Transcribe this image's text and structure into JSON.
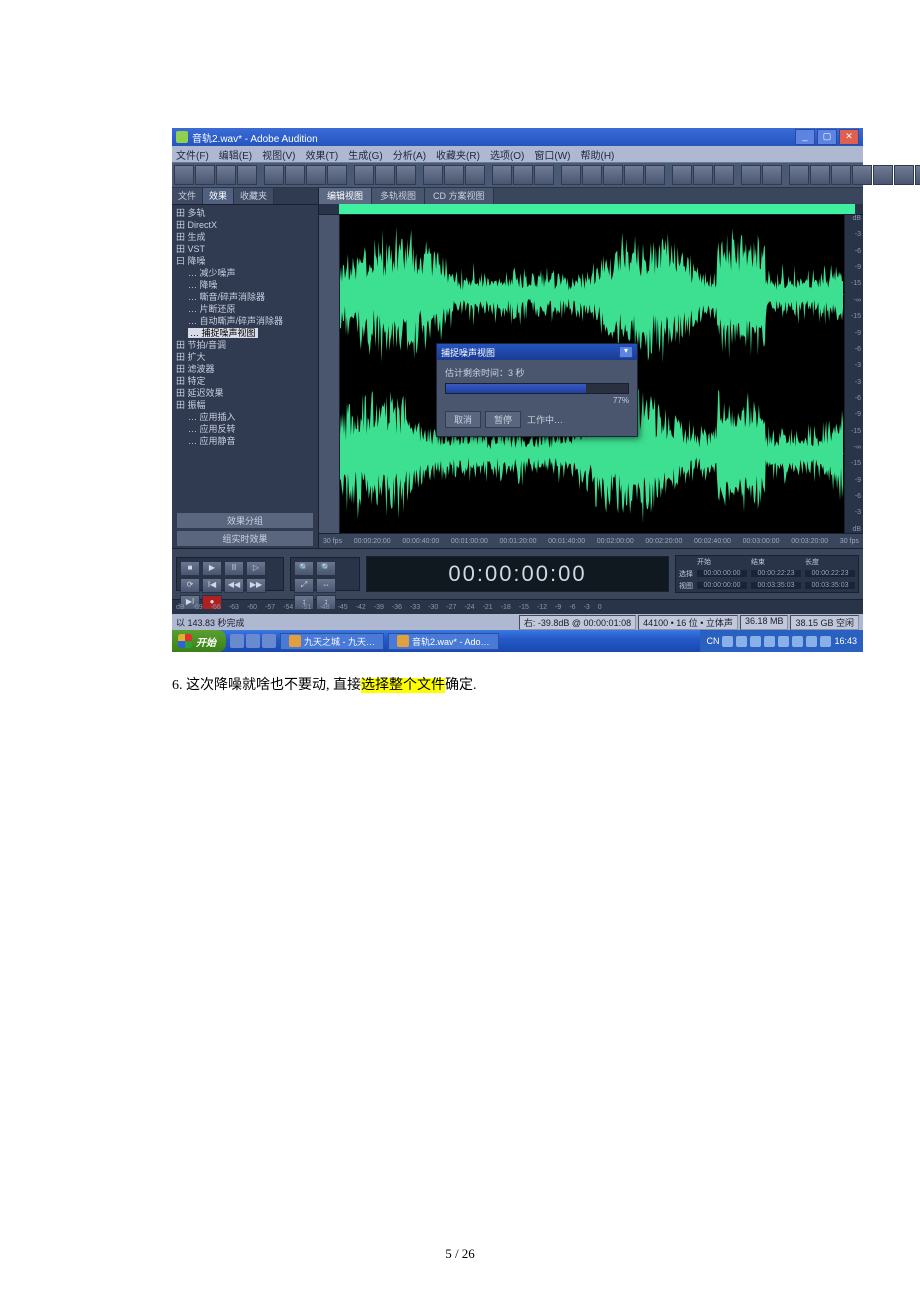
{
  "window": {
    "title": "音轨2.wav* - Adobe Audition"
  },
  "menus": [
    "文件(F)",
    "编辑(E)",
    "视图(V)",
    "效果(T)",
    "生成(G)",
    "分析(A)",
    "收藏夹(R)",
    "选项(O)",
    "窗口(W)",
    "帮助(H)"
  ],
  "left_tabs": {
    "a": "文件",
    "b": "效果",
    "c": "收藏夹",
    "active": "b"
  },
  "tree": [
    {
      "t": "多轨",
      "lv": 0,
      "pre": "田"
    },
    {
      "t": "DirectX",
      "lv": 0,
      "pre": "田"
    },
    {
      "t": "生成",
      "lv": 0,
      "pre": "田"
    },
    {
      "t": "VST",
      "lv": 0,
      "pre": "田"
    },
    {
      "t": "降噪",
      "lv": 0,
      "pre": "曰"
    },
    {
      "t": "减少噪声",
      "lv": 1,
      "pre": "…"
    },
    {
      "t": "降噪",
      "lv": 1,
      "pre": "…"
    },
    {
      "t": "嘶音/碎声消除器",
      "lv": 1,
      "pre": "…"
    },
    {
      "t": "片断还原",
      "lv": 1,
      "pre": "…"
    },
    {
      "t": "自动嘶声/碎声消除器",
      "lv": 1,
      "pre": "…"
    },
    {
      "t": "捕捉噪声视图",
      "lv": 1,
      "pre": "…",
      "hi": true
    },
    {
      "t": "节拍/音调",
      "lv": 0,
      "pre": "田"
    },
    {
      "t": "扩大",
      "lv": 0,
      "pre": "田"
    },
    {
      "t": "滤波器",
      "lv": 0,
      "pre": "田"
    },
    {
      "t": "特定",
      "lv": 0,
      "pre": "田"
    },
    {
      "t": "延迟效果",
      "lv": 0,
      "pre": "田"
    },
    {
      "t": "振幅",
      "lv": 0,
      "pre": "田"
    },
    {
      "t": "应用插入",
      "lv": 1,
      "pre": "…"
    },
    {
      "t": "应用反转",
      "lv": 1,
      "pre": "…"
    },
    {
      "t": "应用静音",
      "lv": 1,
      "pre": "…"
    }
  ],
  "left_bottom": {
    "a": "效果分组",
    "b": "组实时效果"
  },
  "editor_tabs": {
    "a": "编辑视图",
    "b": "多轨视图",
    "c": "CD 方案视图",
    "active": "a"
  },
  "scale": {
    "labels_top": [
      "dB",
      "-3",
      "-6",
      "-9",
      "-15",
      "-∞",
      "-15",
      "-9",
      "-6",
      "-3"
    ],
    "labels_bot": [
      "-3",
      "-6",
      "-9",
      "-15",
      "-∞",
      "-15",
      "-9",
      "-6",
      "-3",
      "dB"
    ]
  },
  "ruler_start": "30 fps",
  "ruler_end": "30 fps",
  "ruler_marks": [
    "00:00:20:00",
    "00:00:40:00",
    "00:01:00:00",
    "00:01:20:00",
    "00:01:40:00",
    "00:02:00:00",
    "00:02:20:00",
    "00:02:40:00",
    "00:03:00:00",
    "00:03:20:00"
  ],
  "dialog": {
    "title": "捕捉噪声视图",
    "est": "估计剩余时间：3 秒",
    "percent": "77%",
    "btn_cancel": "取消",
    "btn_pause": "暂停",
    "status": "工作中…"
  },
  "transport": {
    "btn_stop": "■",
    "btn_play": "▶",
    "btn_pause": "II",
    "btn_playsel": "▷",
    "btn_loop": "⟳",
    "btn_begin": "I◀",
    "btn_rew": "◀◀",
    "btn_ffw": "▶▶",
    "btn_end": "▶I",
    "btn_rec": "●",
    "zoom_in": "🔍",
    "zoom_out": "🔍",
    "zoom_full": "⤢",
    "zoom_sel": "⇔",
    "zoom_v1": "↕",
    "zoom_v2": "↕"
  },
  "bigtime": "00:00:00:00",
  "seltime": {
    "h1": "开始",
    "h2": "结束",
    "h3": "长度",
    "r1": "选择",
    "v11": "00:00:00:00",
    "v12": "00:00:22:23",
    "v13": "00:00:22:23",
    "r2": "视图",
    "v21": "00:00:00:00",
    "v22": "00:03:35:03",
    "v23": "00:03:35:03"
  },
  "db_marks": [
    "dB",
    "-69",
    "-66",
    "-63",
    "-60",
    "-57",
    "-54",
    "-51",
    "-48",
    "-45",
    "-42",
    "-39",
    "-36",
    "-33",
    "-30",
    "-27",
    "-24",
    "-21",
    "-18",
    "-15",
    "-12",
    "-9",
    "-6",
    "-3",
    "0"
  ],
  "status": {
    "left": "以 143.83 秒完成",
    "r1": "右: -39.8dB @ 00:00:01:08",
    "r2": "44100 • 16 位 • 立体声",
    "r3": "36.18 MB",
    "r4": "38.15 GB 空闲"
  },
  "taskbar": {
    "start": "开始",
    "task1": "九天之城 - 九天…",
    "task2": "音轨2.wav* - Ado…",
    "lang": "CN",
    "time": "16:43"
  },
  "caption": {
    "pre": "6. 这次降噪就啥也不要动, 直接",
    "hl": "选择整个文件",
    "post": "确定."
  },
  "pagenum": "5 / 26"
}
